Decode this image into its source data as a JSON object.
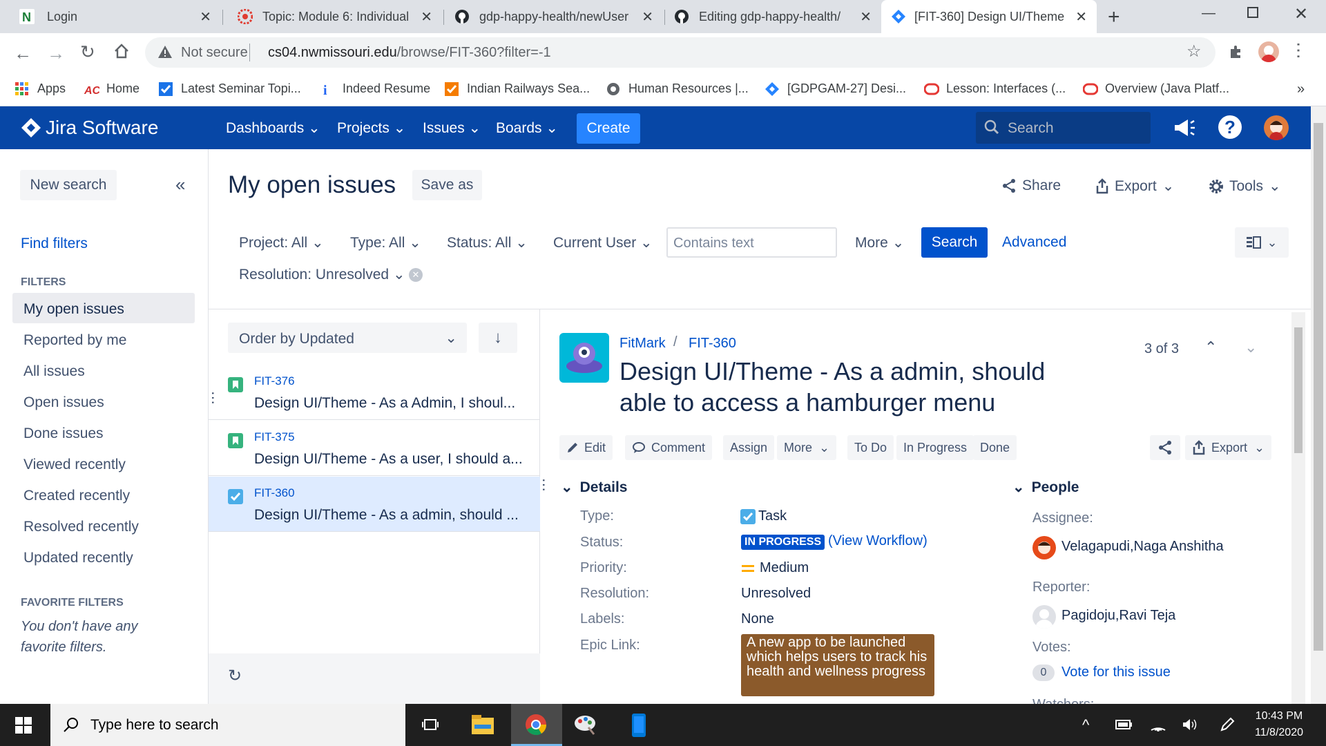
{
  "browser": {
    "tabs": [
      {
        "title": "Login"
      },
      {
        "title": "Topic: Module 6: Individual"
      },
      {
        "title": "gdp-happy-health/newUser"
      },
      {
        "title": "Editing gdp-happy-health/"
      },
      {
        "title": "[FIT-360] Design UI/Theme"
      }
    ],
    "security": "Not secure",
    "url_host": "cs04.nwmissouri.edu",
    "url_path": "/browse/FIT-360?filter=-1",
    "bookmarks": [
      "Apps",
      "Home",
      "Latest Seminar Topi...",
      "Indeed Resume",
      "Indian Railways Sea...",
      "Human Resources |...",
      "[GDPGAM-27] Desi...",
      "Lesson: Interfaces (...",
      "Overview (Java Platf..."
    ]
  },
  "jira": {
    "logo": "Jira Software",
    "nav": {
      "dashboards": "Dashboards",
      "projects": "Projects",
      "issues": "Issues",
      "boards": "Boards",
      "create": "Create"
    },
    "search_placeholder": "Search"
  },
  "sidebar": {
    "new_search": "New search",
    "find_filters": "Find filters",
    "filters_heading": "FILTERS",
    "filters": [
      "My open issues",
      "Reported by me",
      "All issues",
      "Open issues",
      "Done issues",
      "Viewed recently",
      "Created recently",
      "Resolved recently",
      "Updated recently"
    ],
    "favorite_heading": "FAVORITE FILTERS",
    "favorite_empty": "You don't have any favorite filters."
  },
  "header": {
    "title": "My open issues",
    "save_as": "Save as",
    "share": "Share",
    "export": "Export",
    "tools": "Tools"
  },
  "filters": {
    "project": "Project: All",
    "type": "Type: All",
    "status": "Status: All",
    "current_user": "Current User",
    "text_placeholder": "Contains text",
    "more": "More",
    "search": "Search",
    "advanced": "Advanced",
    "resolution": "Resolution: Unresolved"
  },
  "issue_list": {
    "order_by": "Order by Updated",
    "items": [
      {
        "key": "FIT-376",
        "summary": "Design UI/Theme - As a Admin, I shoul..."
      },
      {
        "key": "FIT-375",
        "summary": "Design UI/Theme - As a user, I should a..."
      },
      {
        "key": "FIT-360",
        "summary": "Design UI/Theme - As a admin, should ..."
      }
    ]
  },
  "issue": {
    "project": "FitMark",
    "key": "FIT-360",
    "pager": "3 of 3",
    "title_line1": "Design UI/Theme - As a admin, should",
    "title_line2": "able to access a hamburger menu",
    "actions": {
      "edit": "Edit",
      "comment": "Comment",
      "assign": "Assign",
      "more": "More",
      "todo": "To Do",
      "inprogress": "In Progress",
      "done": "Done",
      "export": "Export"
    },
    "details_heading": "Details",
    "details": {
      "type_label": "Type:",
      "type": "Task",
      "status_label": "Status:",
      "status": "IN PROGRESS",
      "workflow": "(View Workflow)",
      "priority_label": "Priority:",
      "priority": "Medium",
      "resolution_label": "Resolution:",
      "resolution": "Unresolved",
      "labels_label": "Labels:",
      "labels": "None",
      "epic_label": "Epic Link:",
      "epic": "A new app to be launched which helps users to track his health and wellness progress"
    },
    "people_heading": "People",
    "people": {
      "assignee_label": "Assignee:",
      "assignee": "Velagapudi,Naga Anshitha",
      "reporter_label": "Reporter:",
      "reporter": "Pagidoju,Ravi Teja",
      "votes_label": "Votes:",
      "votes_count": "0",
      "vote_link": "Vote for this issue",
      "watchers_label": "Watchers:"
    }
  },
  "taskbar": {
    "search_placeholder": "Type here to search",
    "time": "10:43 PM",
    "date": "11/8/2020"
  },
  "colors": {
    "jira_blue": "#0747a6",
    "link": "#0052cc",
    "status_bg": "#0052cc",
    "epic_bg": "#8b5a2b",
    "priority": "#ffab00"
  }
}
